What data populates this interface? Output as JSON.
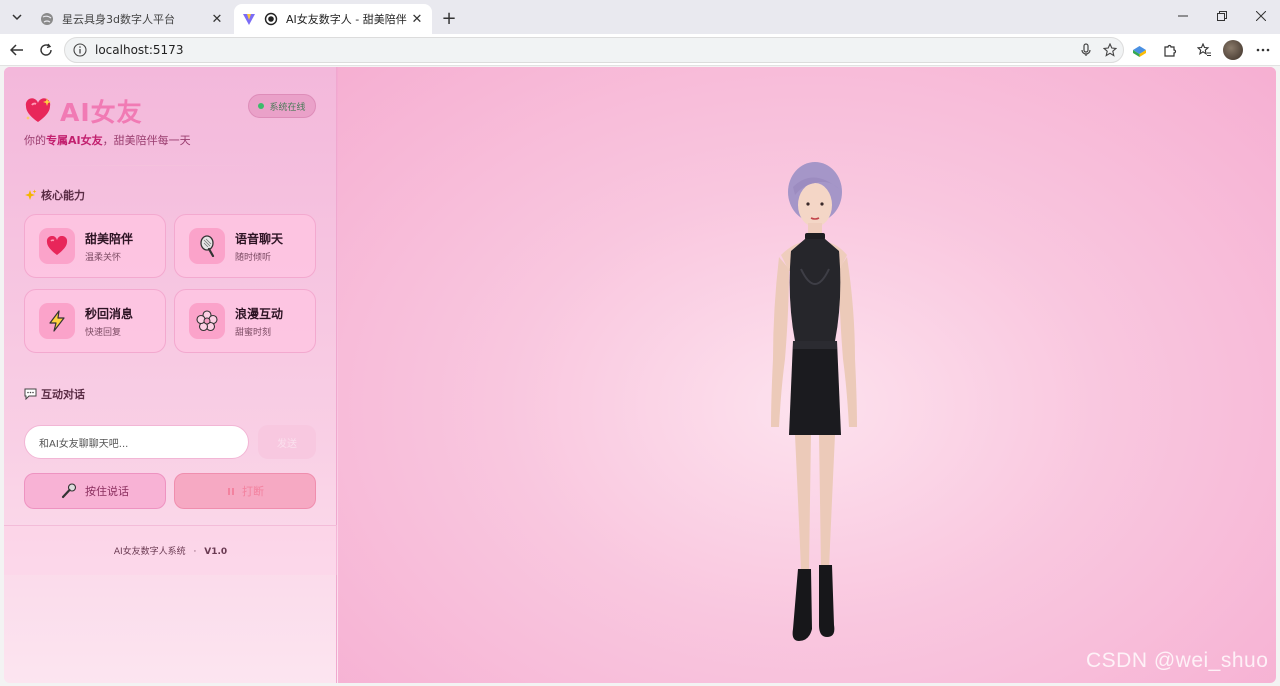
{
  "browser": {
    "tabs": [
      {
        "title": "星云具身3d数字人平台",
        "active": false
      },
      {
        "title": "AI女友数字人 - 甜美陪伴",
        "active": true
      }
    ],
    "url": "localhost:5173"
  },
  "sidebar": {
    "brand": "AI女友",
    "tagline_prefix": "你的",
    "tagline_bold": "专属AI女友",
    "tagline_suffix": "，甜美陪伴每一天",
    "status": "系统在线",
    "capabilities_title": "核心能力",
    "capabilities": [
      {
        "title": "甜美陪伴",
        "subtitle": "温柔关怀",
        "icon": "heart-icon"
      },
      {
        "title": "语音聊天",
        "subtitle": "随时倾听",
        "icon": "microphone-icon"
      },
      {
        "title": "秒回消息",
        "subtitle": "快速回复",
        "icon": "lightning-icon"
      },
      {
        "title": "浪漫互动",
        "subtitle": "甜蜜时刻",
        "icon": "flower-icon"
      }
    ],
    "chat_title": "互动对话",
    "input_placeholder": "和AI女友聊聊天吧...",
    "send_label": "发送",
    "voice_label": "按住说话",
    "stop_label": "打断",
    "footer_name": "AI女友数字人系统",
    "footer_sep": "·",
    "footer_version": "V1.0"
  },
  "watermark": "CSDN @wei_shuo",
  "colors": {
    "accent": "#f17ab4",
    "status": "#3cbb6b"
  }
}
